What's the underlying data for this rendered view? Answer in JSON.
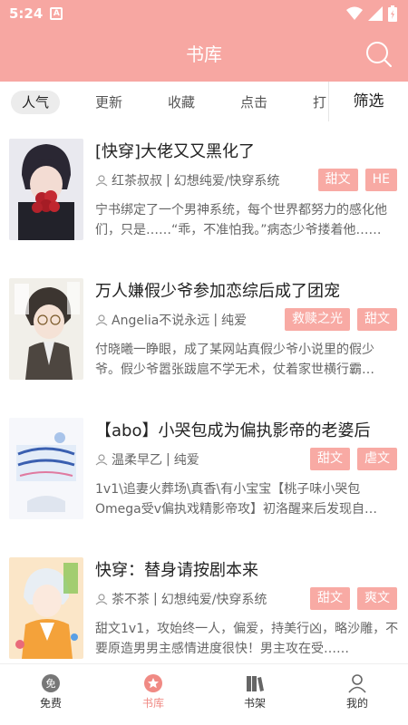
{
  "status_bar": {
    "time": "5:24",
    "app_letter": "A"
  },
  "header": {
    "title": "书库"
  },
  "tabs": [
    {
      "label": "人气",
      "active": true
    },
    {
      "label": "更新",
      "active": false
    },
    {
      "label": "收藏",
      "active": false
    },
    {
      "label": "点击",
      "active": false
    },
    {
      "label": "打",
      "active": false
    }
  ],
  "filter_label": "筛选",
  "books": [
    {
      "title": "[快穿]大佬又又黑化了",
      "author": "红茶叔叔",
      "category": "幻想纯爱/快穿系统",
      "tags": [
        "甜文",
        "HE"
      ],
      "description": "宁书绑定了一个男神系统，每个世界都努力的感化他们，只是……“乖，不准怕我。”病态少爷搂着他……"
    },
    {
      "title": "万人嫌假少爷参加恋综后成了团宠",
      "author": "Angelia不说永远",
      "category": "纯爱",
      "tags": [
        "救赎之光",
        "甜文"
      ],
      "description": "付晓曦一睁眼，成了某网站真假少爷小说里的假少爷。假少爷嚣张跋扈不学无术，仗着家世横行霸道……"
    },
    {
      "title": "【abo】小哭包成为偏执影帝的老婆后",
      "author": "温柔早乙",
      "category": "纯爱",
      "tags": [
        "甜文",
        "虐文"
      ],
      "description": "1v1\\追妻火葬场\\真香\\有小宝宝【桃子味小哭包Omega受v偏执戏精影帝攻】初洛醒来后发现自己……"
    },
    {
      "title": "快穿：替身请按剧本来",
      "author": "茶不茶",
      "category": "幻想纯爱/快穿系统",
      "tags": [
        "甜文",
        "爽文"
      ],
      "description": "甜文1v1，攻始终一人，偏爱，持美行凶，略沙雕，不要原造男男主感情进度很快！男主攻在受……"
    }
  ],
  "bottom_nav": [
    {
      "label": "免费",
      "icon": "free-icon",
      "active": false
    },
    {
      "label": "书库",
      "icon": "star-circle-icon",
      "active": true
    },
    {
      "label": "书架",
      "icon": "bookshelf-icon",
      "active": false
    },
    {
      "label": "我的",
      "icon": "person-icon",
      "active": false
    }
  ],
  "colors": {
    "brand": "#f7a7a2",
    "tag": "#f8aaa4",
    "active_nav": "#f08a84"
  }
}
